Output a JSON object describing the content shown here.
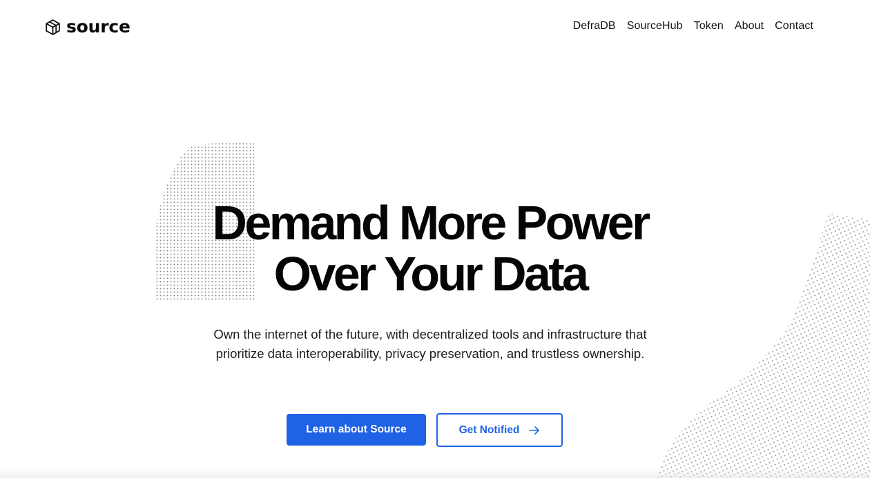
{
  "header": {
    "logo_text": "source",
    "logo_icon": "source-hexagon-logo-icon",
    "nav": [
      {
        "label": "DefraDB"
      },
      {
        "label": "SourceHub"
      },
      {
        "label": "Token"
      },
      {
        "label": "About"
      },
      {
        "label": "Contact"
      }
    ]
  },
  "hero": {
    "title_line1": "Demand More Power",
    "title_line2": "Over Your Data",
    "subtitle_line1": "Own the internet of the future, with decentralized tools and infrastructure that",
    "subtitle_line2": "prioritize data interoperability, privacy preservation, and trustless ownership."
  },
  "buttons": {
    "primary_label": "Learn about Source",
    "secondary_label": "Get Notified",
    "secondary_icon": "arrow-right-icon"
  },
  "colors": {
    "accent": "#1f62e6",
    "text": "#050505",
    "dots": "#b5b5b5"
  }
}
